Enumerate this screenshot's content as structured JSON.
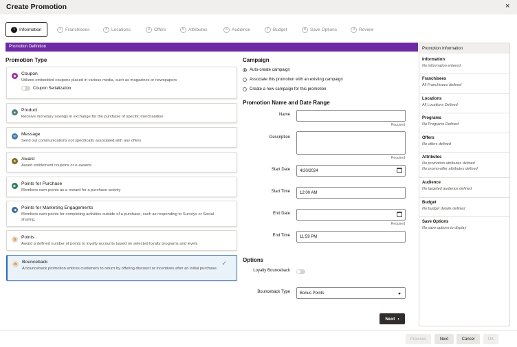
{
  "header": {
    "title": "Create Promotion",
    "close_glyph": "×"
  },
  "train": [
    {
      "num": "1",
      "label": "Information"
    },
    {
      "num": "2",
      "label": "Franchisees"
    },
    {
      "num": "3",
      "label": "Locations"
    },
    {
      "num": "4",
      "label": "Offers"
    },
    {
      "num": "5",
      "label": "Attributes"
    },
    {
      "num": "6",
      "label": "Audience"
    },
    {
      "num": "7",
      "label": "Budget"
    },
    {
      "num": "8",
      "label": "Save Options"
    },
    {
      "num": "9",
      "label": "Review"
    }
  ],
  "section_bar": "Promotion Definition",
  "promotion_type": {
    "heading": "Promotion Type",
    "items": [
      {
        "title": "Coupon",
        "desc": "Utilizes embedded coupons placed in various media, such as magazines or newspapers",
        "icon": "coupon-icon",
        "color": "#a4309c"
      },
      {
        "title": "Product",
        "desc": "Receive monetary savings in exchange for the purchase of specific merchandise",
        "icon": "product-icon",
        "color": "#4f8680"
      },
      {
        "title": "Message",
        "desc": "Send out communications not specifically associated with any offers",
        "icon": "message-icon",
        "color": "#3f78a9"
      },
      {
        "title": "Award",
        "desc": "Award entitlement coupons or e-awards",
        "icon": "award-icon",
        "color": "#8a6a1f"
      },
      {
        "title": "Points for Purchase",
        "desc": "Members earn points as a reward for a purchase activity",
        "icon": "points-purchase-icon",
        "color": "#2f7d5a"
      },
      {
        "title": "Points for Marketing Engagements",
        "desc": "Members earn points for completing activities outside of a purchase, such as responding to Surveys or Social sharing.",
        "icon": "marketing-icon",
        "color": "#3a6aa0"
      },
      {
        "title": "Points",
        "desc": "Award a defined number of points to loyalty accounts based on selected loyalty programs and levels",
        "icon": "points-icon",
        "color": "#f0d7bd"
      },
      {
        "title": "Bounceback",
        "desc": "A bounceback promotion entices customers to return by offering discount or incentives after an initial purchase.",
        "icon": "bounceback-icon",
        "color": "#f0d7bd"
      }
    ],
    "coupon_serialization": "Coupon Serialization"
  },
  "campaign": {
    "heading": "Campaign",
    "options": [
      "Auto-create campaign",
      "Associate this promotion with an existing campaign",
      "Create a new campaign for this promotion"
    ]
  },
  "name_date": {
    "heading": "Promotion Name and Date Range",
    "name_label": "Name",
    "description_label": "Description",
    "required": "Required",
    "start_date_label": "Start Date",
    "start_date": "4/20/2024",
    "start_time_label": "Start Time",
    "start_time": "12:00 AM",
    "end_date_label": "End Date",
    "end_time_label": "End Time",
    "end_time": "11:59 PM"
  },
  "options": {
    "heading": "Options",
    "loyalty_bounceback_label": "Loyalty Bounceback",
    "bounceback_type_label": "Bounceback Type",
    "bounceback_type": "Bonus Points"
  },
  "next_button": "Next",
  "info_panel": {
    "title": "Promotion Information",
    "sections": [
      {
        "title": "Information",
        "value": "No information entered"
      },
      {
        "title": "Franchisees",
        "value": "All Franchisees defined"
      },
      {
        "title": "Locations",
        "value": "All Locations Defined"
      },
      {
        "title": "Programs",
        "value": "No Programs Defined"
      },
      {
        "title": "Offers",
        "value": "No offers defined"
      },
      {
        "title": "Attributes",
        "value": "No promotion attributes defined",
        "value2": "No promo-offer attributes defined"
      },
      {
        "title": "Audience",
        "value": "No targeted audience defined"
      },
      {
        "title": "Budget",
        "value": "No budget details defined"
      },
      {
        "title": "Save Options",
        "value": "No save options to display"
      }
    ]
  },
  "footer": {
    "previous": "Previous",
    "next": "Next",
    "cancel": "Cancel",
    "ok": "OK"
  }
}
